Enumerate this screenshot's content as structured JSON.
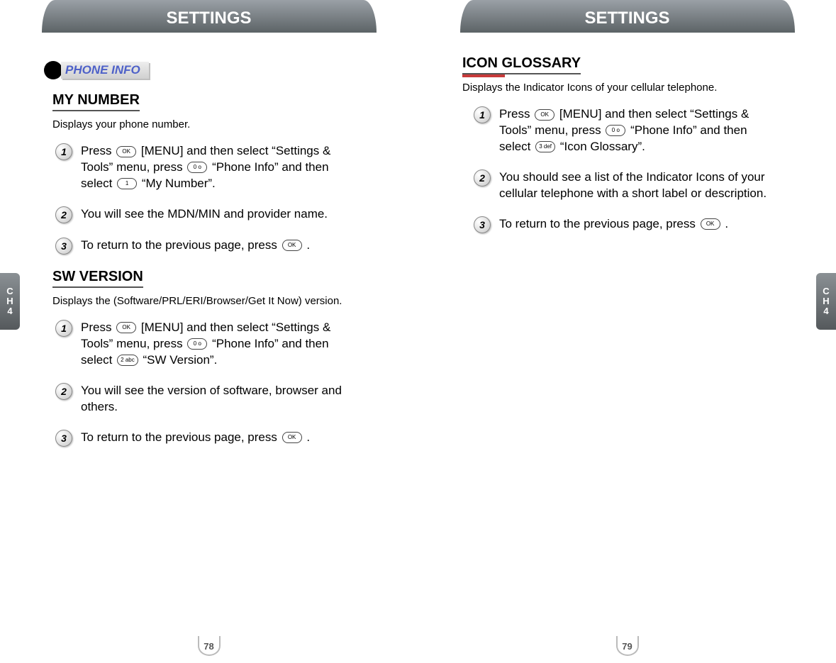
{
  "left": {
    "header": "SETTINGS",
    "tab_line1": "C",
    "tab_line2": "H",
    "tab_line3": "4",
    "pagenum": "78",
    "section_label": "PHONE INFO",
    "mynumber": {
      "title": "MY NUMBER",
      "deck": "Displays your phone number.",
      "step1_a": "Press ",
      "step1_ok": "OK",
      "step1_b": " [MENU] and then select “Settings & Tools” menu, press ",
      "step1_key0": "0 o",
      "step1_c": " “Phone Info” and then select ",
      "step1_key1": "1",
      "step1_d": " “My Number”.",
      "step2": "You will see the MDN/MIN and provider name.",
      "step3_a": "To return to the previous page, press ",
      "step3_ok": "OK",
      "step3_b": " ."
    },
    "swversion": {
      "title": "SW VERSION",
      "deck": "Displays the (Software/PRL/ERI/Browser/Get It Now) version.",
      "step1_a": "Press ",
      "step1_ok": "OK",
      "step1_b": " [MENU] and then select “Settings & Tools” menu, press ",
      "step1_key0": "0 o",
      "step1_c": " “Phone Info” and then select ",
      "step1_key2": "2 abc",
      "step1_d": " “SW Version”.",
      "step2": "You will see the version of software, browser and others.",
      "step3_a": "To return to the previous page, press ",
      "step3_ok": "OK",
      "step3_b": " ."
    }
  },
  "right": {
    "header": "SETTINGS",
    "tab_line1": "C",
    "tab_line2": "H",
    "tab_line3": "4",
    "pagenum": "79",
    "iconglossary": {
      "title": "ICON GLOSSARY",
      "deck": "Displays the Indicator Icons of your cellular telephone.",
      "step1_a": "Press ",
      "step1_ok": "OK",
      "step1_b": " [MENU] and then select “Settings & Tools” menu, press ",
      "step1_key0": "0 o",
      "step1_c": " “Phone Info” and then select ",
      "step1_key3": "3 def",
      "step1_d": " “Icon Glossary”.",
      "step2": "You should see a list of the Indicator Icons of your cellular telephone with a short label or description.",
      "step3_a": "To return to the previous page, press ",
      "step3_ok": "OK",
      "step3_b": " ."
    }
  }
}
